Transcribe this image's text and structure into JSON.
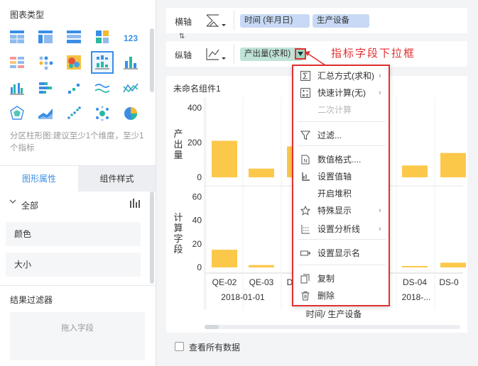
{
  "left_panel": {
    "chart_types_title": "图表类型",
    "chart_types": [
      "table-icon",
      "cross-table-icon",
      "freeform-table-icon",
      "heatmap-grid-icon",
      "number-kpi-icon",
      "color-table-icon",
      "dot-matrix-icon",
      "heat-map-icon",
      "partition-column-icon",
      "column-icon",
      "grouped-column-icon",
      "bar-icon",
      "scatter-step-icon",
      "line-wave-icon",
      "line-cross-icon",
      "radar-icon",
      "area-icon",
      "scatter-icon",
      "bubble-icon",
      "pie-icon"
    ],
    "selected_index": 8,
    "hint": "分区柱形图:建议至少1个维度，至少1个指标",
    "tab_properties": "图形属性",
    "tab_style": "组件样式",
    "all_label": "全部",
    "color_label": "颜色",
    "size_label": "大小",
    "filter_title": "结果过滤器",
    "drop_hint": "拖入字段"
  },
  "axes": {
    "horizontal_label": "横轴",
    "vertical_label": "纵轴",
    "x_fields": [
      "时间 (年月日)",
      "生产设备"
    ],
    "y_field": "产出量(求和)"
  },
  "annotation": "指标字段下拉框",
  "chart": {
    "title": "未命名组件1",
    "top_axis_label": "产出量",
    "bottom_axis_label": "计算字段",
    "top_ticks": [
      "400",
      "200",
      "0"
    ],
    "bottom_ticks": [
      "60",
      "40",
      "20",
      "0"
    ],
    "x_ticks": [
      "QE-02",
      "QE-03",
      "D",
      "DS-04",
      "DS-0"
    ],
    "x_group_labels": [
      "2018-01-01",
      "2018-..."
    ],
    "x_axis_title": "时间/ 生产设备"
  },
  "chart_data": {
    "type": "bar",
    "categories": [
      "QE-02",
      "QE-03",
      "D",
      "",
      "",
      "DS-04",
      "DS-0"
    ],
    "series": [
      {
        "name": "产出量",
        "values": [
          210,
          50,
          178,
          null,
          null,
          68,
          140
        ]
      },
      {
        "name": "计算字段",
        "values": [
          15,
          2,
          null,
          null,
          null,
          1,
          4
        ]
      }
    ],
    "ylim_top": [
      0,
      420
    ],
    "ylim_bottom": [
      0,
      65
    ]
  },
  "menu": {
    "items": [
      {
        "label": "汇总方式(求和)",
        "icon": "sigma-icon",
        "submenu": true
      },
      {
        "label": "快速计算(无)",
        "icon": "calculator-icon",
        "submenu": true
      },
      {
        "label": "二次计算",
        "icon": "",
        "disabled": true
      },
      {
        "label": "过滤...",
        "icon": "filter-icon"
      },
      {
        "label": "数值格式....",
        "icon": "number-format-icon"
      },
      {
        "label": "设置值轴",
        "icon": "axis-icon"
      },
      {
        "label": "开启堆积",
        "icon": ""
      },
      {
        "label": "特殊显示",
        "icon": "star-icon",
        "submenu": true
      },
      {
        "label": "设置分析线",
        "icon": "analysis-line-icon",
        "submenu": true
      },
      {
        "label": "设置显示名",
        "icon": "rename-icon"
      },
      {
        "label": "复制",
        "icon": "copy-icon"
      },
      {
        "label": "删除",
        "icon": "trash-icon"
      }
    ]
  },
  "footer": {
    "view_all_label": "查看所有数据"
  },
  "colors": {
    "accent": "#3a8ee6",
    "bar": "#fcc84a",
    "highlight": "#e03030"
  }
}
